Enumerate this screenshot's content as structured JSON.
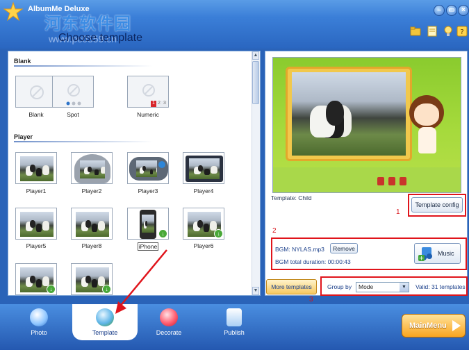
{
  "app": {
    "title": "AlbumMe Deluxe",
    "page_heading": "Choose template",
    "watermark_cn": "河东软件园",
    "watermark_url": "www.pc0359.cn"
  },
  "window_controls": [
    "minimize",
    "restore",
    "close"
  ],
  "toolbar_icons": [
    "folder-icon",
    "note-icon",
    "bulb-icon",
    "help-icon"
  ],
  "template_list": {
    "sections": [
      {
        "title": "Blank",
        "items": [
          {
            "label": "Blank"
          },
          {
            "label": "Spot"
          },
          {
            "label": "Numeric"
          }
        ]
      },
      {
        "title": "Player",
        "items": [
          {
            "label": "Player1"
          },
          {
            "label": "Player2"
          },
          {
            "label": "Player3"
          },
          {
            "label": "Player4"
          },
          {
            "label": "Player5"
          },
          {
            "label": "Player8"
          },
          {
            "label": "iPhone",
            "selected": true
          },
          {
            "label": "Player6"
          },
          {
            "label": ""
          },
          {
            "label": ""
          }
        ]
      }
    ],
    "numeric_digits": [
      "1",
      "2",
      "3"
    ]
  },
  "preview": {
    "template_caption": "Template:  Child",
    "template_config_label": "Template config"
  },
  "bgm": {
    "name_label": "BGM: NYLAS.mp3",
    "remove_label": "Remove",
    "duration_label": "BGM total duration: 00:00:43",
    "music_label": "Music"
  },
  "filter": {
    "more_templates_label": "More templates",
    "group_by_label": "Group by",
    "group_by_value": "Mode",
    "valid_label": "Valid: 31 templates"
  },
  "annotations": {
    "num1": "1",
    "num2": "2",
    "num3": "3"
  },
  "bottom_nav": {
    "tabs": [
      {
        "label": "Photo"
      },
      {
        "label": "Template"
      },
      {
        "label": "Decorate"
      },
      {
        "label": "Publish"
      }
    ],
    "main_menu_label": "MainMenu"
  },
  "colors": {
    "accent_blue": "#2a66c0",
    "annotation_red": "#e0141b",
    "main_menu_orange": "#f9a41f"
  }
}
